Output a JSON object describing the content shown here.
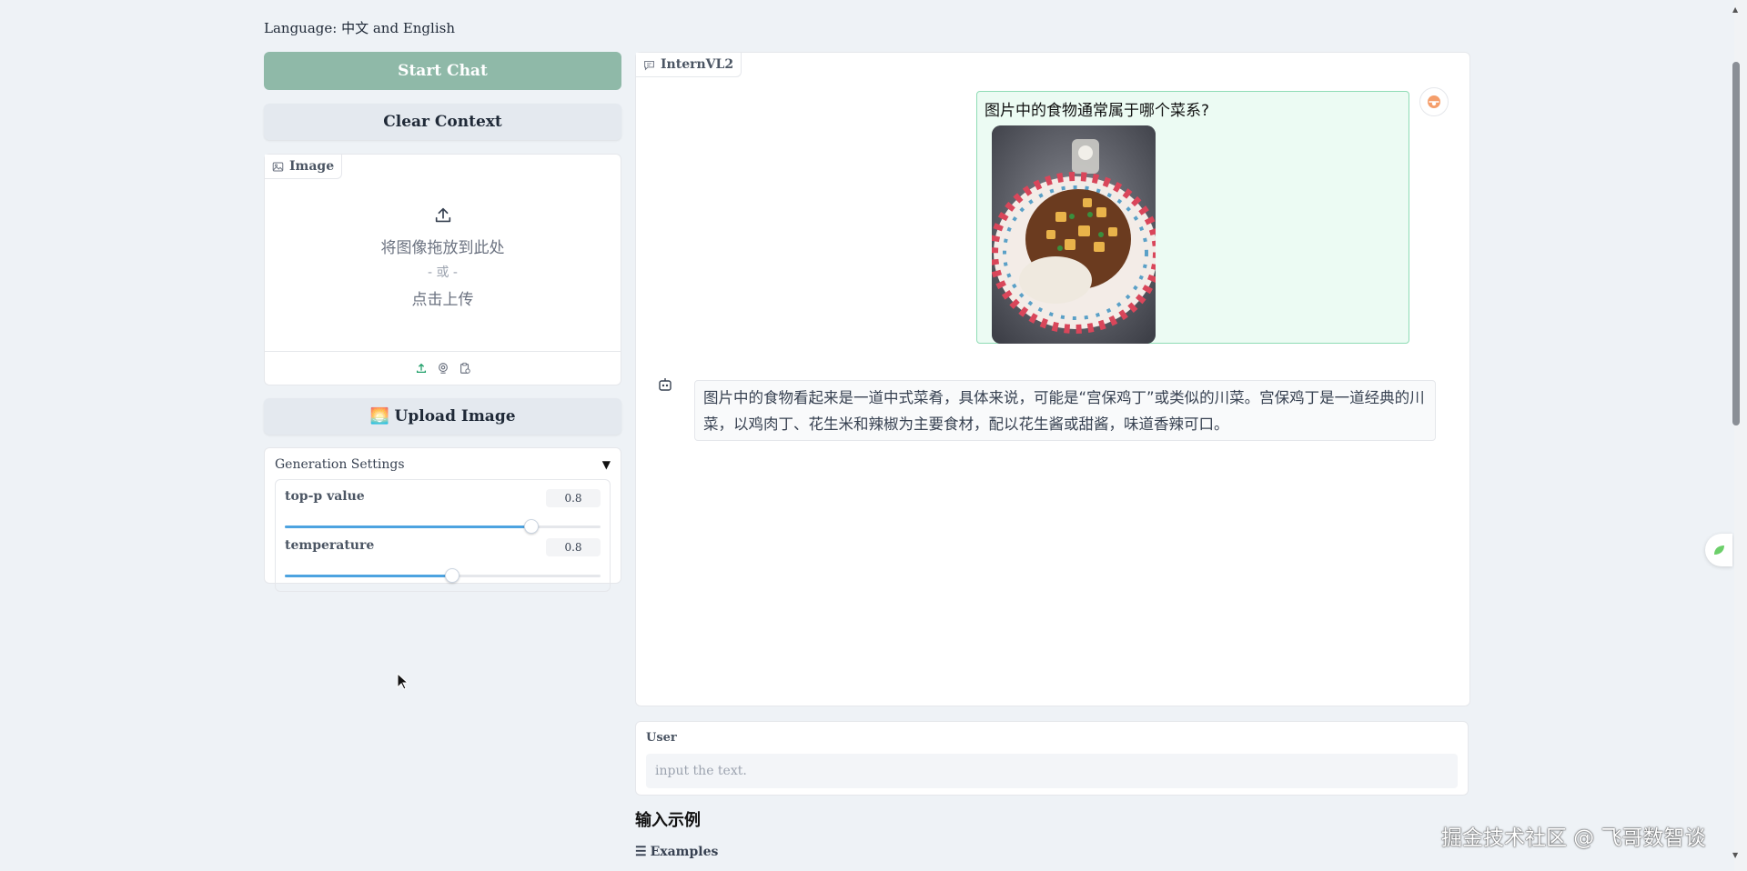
{
  "language_label": "Language: 中文 and English",
  "left": {
    "start_chat": "Start Chat",
    "clear_context": "Clear Context",
    "image_panel": {
      "label": "Image",
      "drop_text": "将图像拖放到此处",
      "or_text": "- 或 -",
      "click_text": "点击上传",
      "sources": [
        "upload-icon",
        "webcam-icon",
        "clipboard-icon"
      ]
    },
    "upload_image": "🌅 Upload Image",
    "generation": {
      "title": "Generation Settings",
      "sliders": [
        {
          "label": "top-p value",
          "value": "0.8",
          "fraction": 0.78
        },
        {
          "label": "temperature",
          "value": "0.8",
          "fraction": 0.53
        }
      ]
    }
  },
  "chat": {
    "label": "InternVL2",
    "user_message": "图片中的食物通常属于哪个菜系?",
    "bot_message": "图片中的食物看起来是一道中式菜肴，具体来说，可能是“宫保鸡丁”或类似的川菜。宫保鸡丁是一道经典的川菜，以鸡肉丁、花生米和辣椒为主要食材，配以花生酱或甜酱，味道香辣可口。"
  },
  "user_input": {
    "label": "User",
    "placeholder": "input the text."
  },
  "examples": {
    "title": "输入示例",
    "label": "Examples"
  },
  "watermark": "掘金技术社区 @ 飞哥数智谈",
  "colors": {
    "primary_button": "#8fb9a8",
    "slider_fill": "#4da3e0",
    "user_bubble": "#ecfbf3",
    "user_bubble_border": "#8fdcb5"
  }
}
